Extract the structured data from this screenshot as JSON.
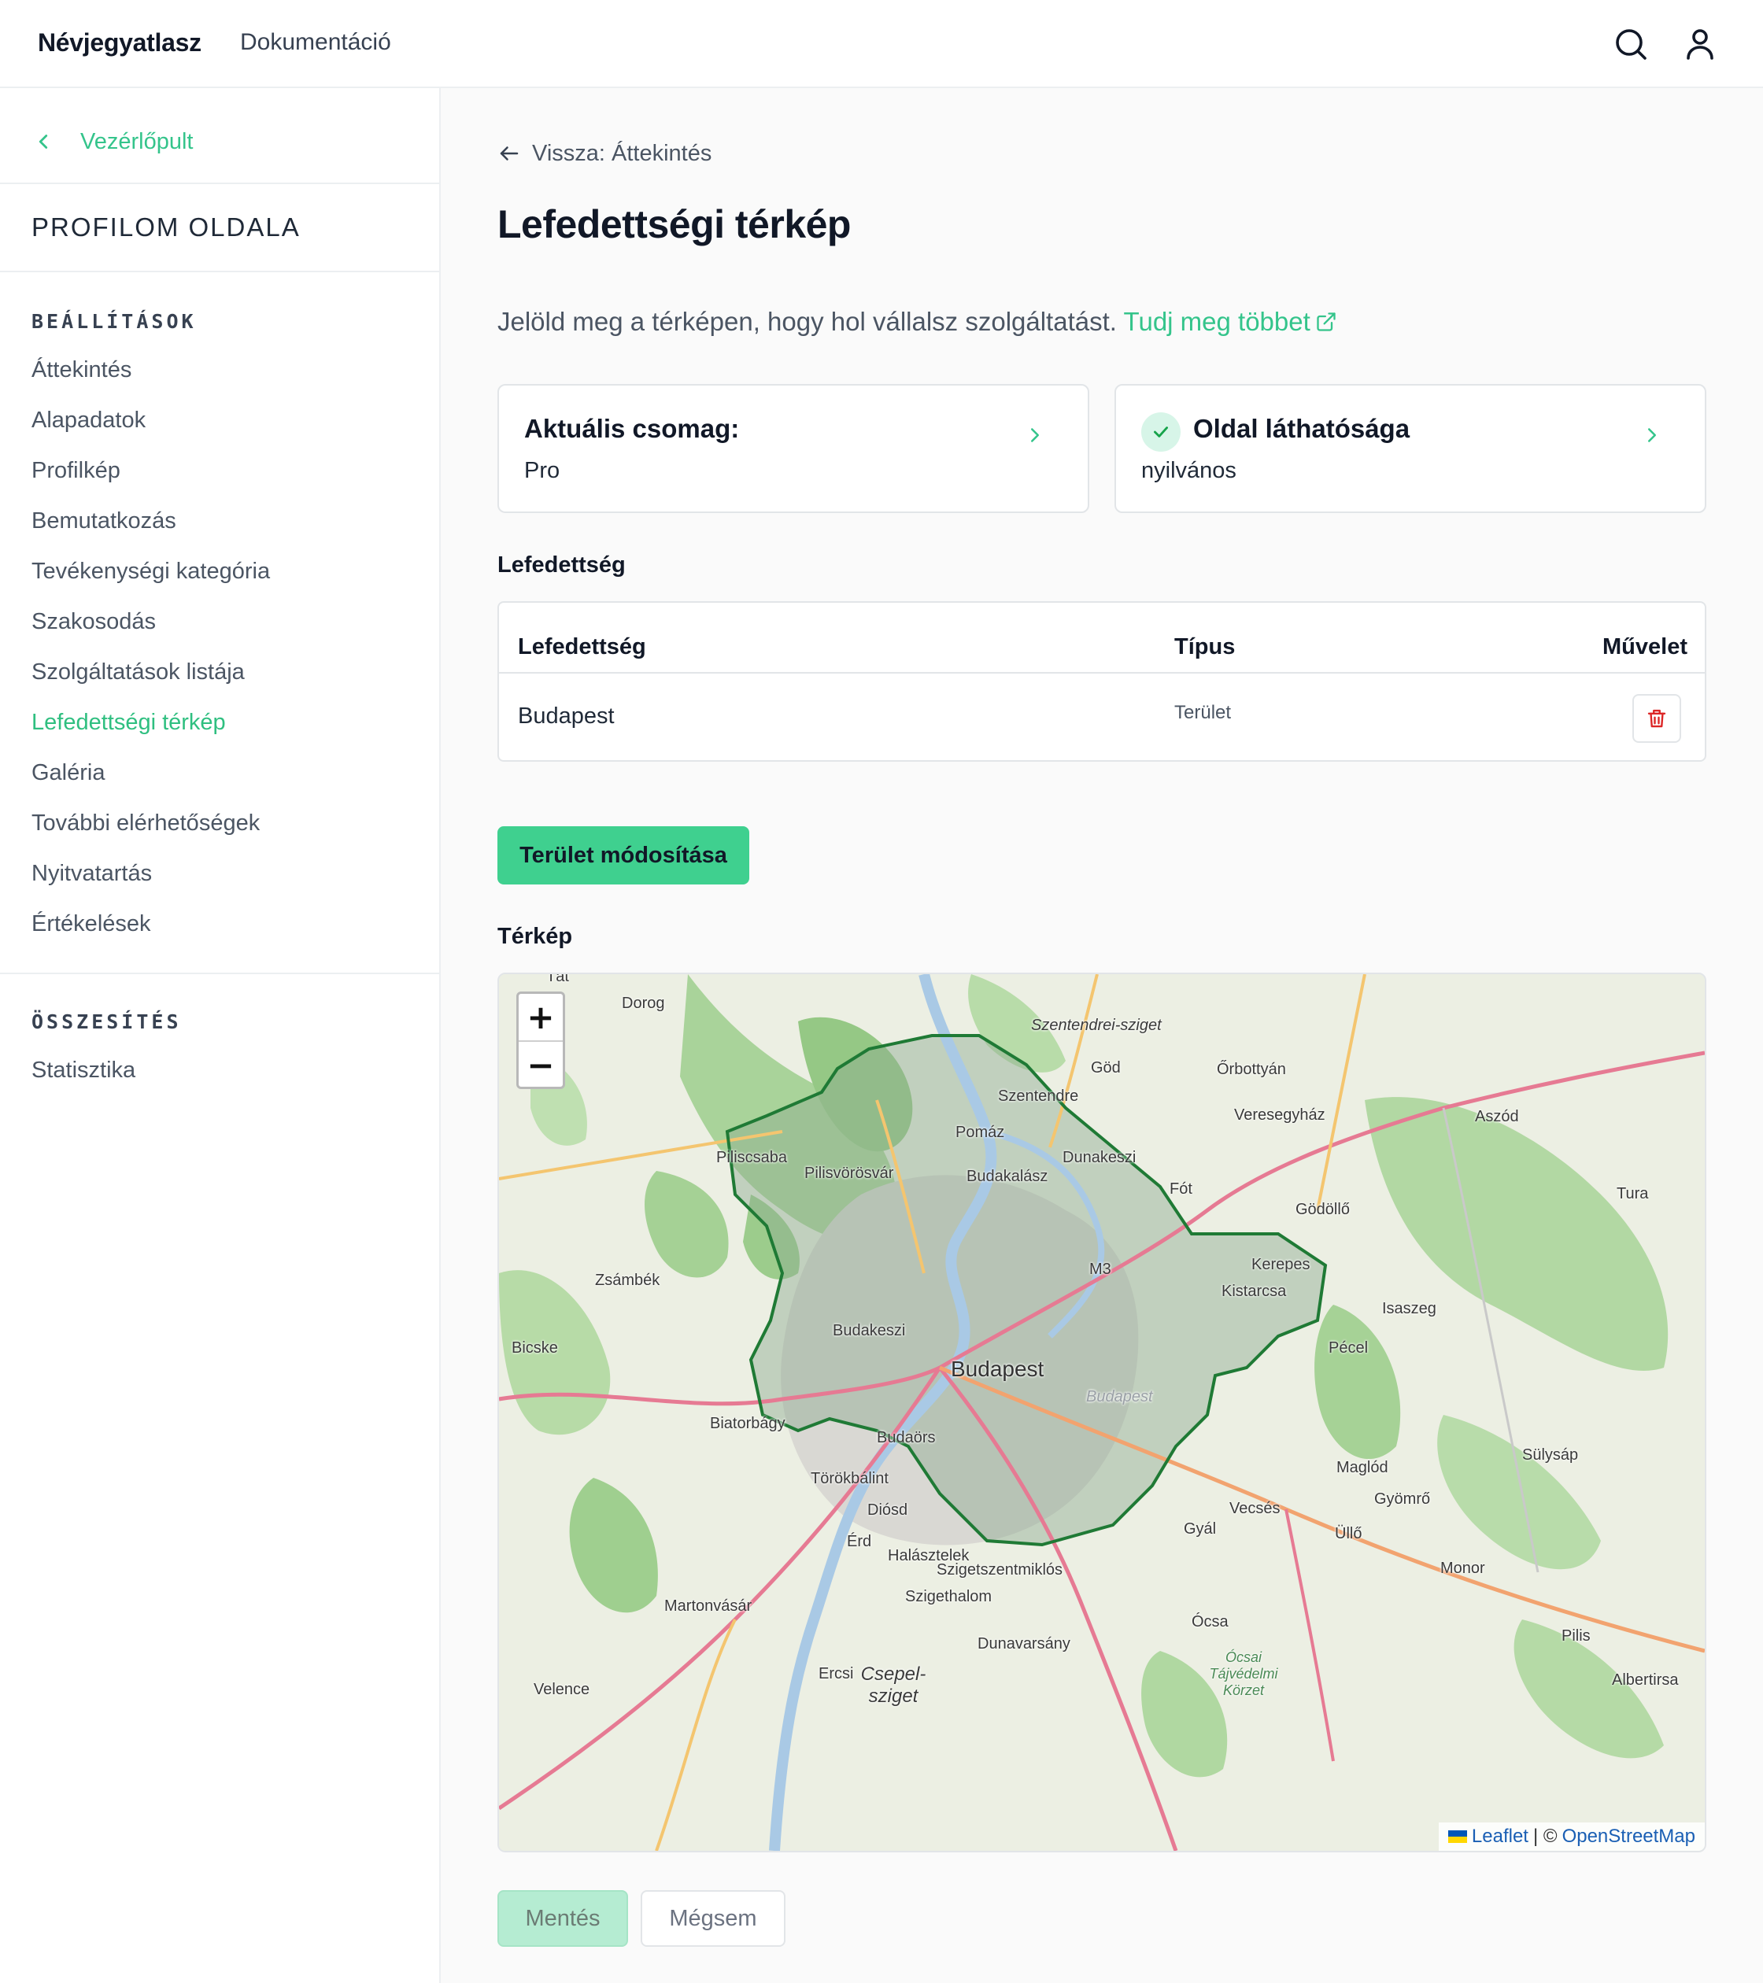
{
  "header": {
    "brand": "Névjegyatlasz",
    "nav_docs": "Dokumentáció",
    "search_icon": "search-icon",
    "user_icon": "user-icon"
  },
  "sidebar": {
    "back_label": "Vezérlőpult",
    "profile_title": "PROFILOM OLDALA",
    "settings_heading": "BEÁLLÍTÁSOK",
    "settings_items": [
      "Áttekintés",
      "Alapadatok",
      "Profilkép",
      "Bemutatkozás",
      "Tevékenységi kategória",
      "Szakosodás",
      "Szolgáltatások listája",
      "Lefedettségi térkép",
      "Galéria",
      "További elérhetőségek",
      "Nyitvatartás",
      "Értékelések"
    ],
    "active_item": "Lefedettségi térkép",
    "summary_heading": "ÖSSZESÍTÉS",
    "summary_items": [
      "Statisztika"
    ]
  },
  "main": {
    "back_link": "Vissza: Áttekintés",
    "title": "Lefedettségi térkép",
    "lead_text": "Jelöld meg a térképen, hogy hol vállalsz szolgáltatást.",
    "lead_link": "Tudj meg többet",
    "package_card": {
      "title": "Aktuális csomag:",
      "value": "Pro"
    },
    "visibility_card": {
      "title": "Oldal láthatósága",
      "value": "nyilvános"
    },
    "coverage_label": "Lefedettség",
    "table": {
      "headers": [
        "Lefedettség",
        "Típus",
        "Művelet"
      ],
      "rows": [
        {
          "coverage": "Budapest",
          "type": "Terület"
        }
      ]
    },
    "modify_button": "Terület módosítása",
    "map_label": "Térkép",
    "map": {
      "zoom_in": "+",
      "zoom_out": "−",
      "attribution_leaflet": "Leaflet",
      "attribution_sep": "| ©",
      "attribution_osm": "OpenStreetMap",
      "places": [
        "Tát",
        "Dorog",
        "Szentendrei-sziget",
        "Göd",
        "Őrbottyán",
        "Szentendre",
        "Veresegyház",
        "Aszód",
        "Pomáz",
        "Piliscsaba",
        "Pilisvörösvár",
        "Dunakeszi",
        "Budakalász",
        "Fót",
        "Tura",
        "Gödöllő",
        "Kerepes",
        "Zsámbék",
        "M3",
        "Kistarcsa",
        "Isaszeg",
        "Budakeszi",
        "Budapest",
        "Bicske",
        "Pécel",
        "Budapest",
        "Biatorbágy",
        "Budaörs",
        "Sülysáp",
        "Maglód",
        "Törökbálint",
        "Gyömrő",
        "Diósd",
        "Vecsés",
        "Gyál",
        "Üllő",
        "Érd",
        "Halásztelek",
        "Monor",
        "Szigetszentmiklós",
        "Szigethalom",
        "Martonvásár",
        "Ócsa",
        "Dunavarsány",
        "Pilis",
        "Ócsai Tájvédelmi Körzet",
        "Ercsi",
        "Csepel-sziget",
        "Albertirsa",
        "Velence"
      ]
    },
    "save_button": "Mentés",
    "cancel_button": "Mégsem"
  },
  "colors": {
    "accent": "#34c48b",
    "primary_button": "#3fd08f",
    "danger": "#dc2626",
    "coverage_outline": "#1f7a35"
  }
}
